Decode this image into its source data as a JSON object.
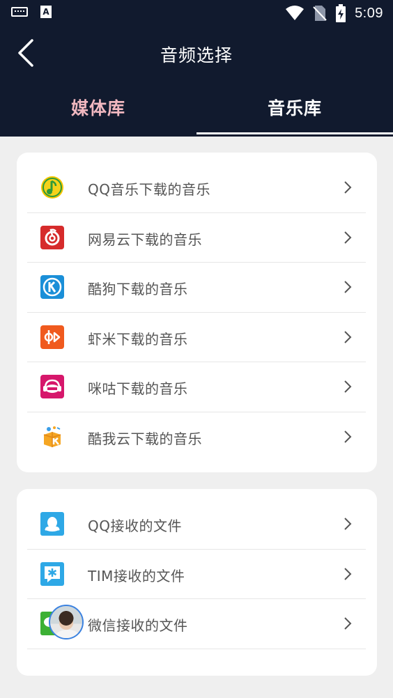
{
  "status_bar": {
    "time": "5:09",
    "icons": [
      "keyboard-icon",
      "a-app-icon",
      "wifi-icon",
      "no-sim-icon",
      "battery-charging-icon"
    ]
  },
  "header": {
    "title": "音频选择",
    "back_icon": "chevron-left-icon",
    "bg_color": "#111a2e"
  },
  "tabs": [
    {
      "label": "媒体库",
      "active": false,
      "color": "#f1b8c0"
    },
    {
      "label": "音乐库",
      "active": true,
      "color": "#ffffff"
    }
  ],
  "music_sources": [
    {
      "label": "QQ音乐下载的音乐",
      "icon": "qq-music-icon",
      "color": "#f7c600"
    },
    {
      "label": "网易云下载的音乐",
      "icon": "netease-cloud-music-icon",
      "color": "#d62b2b"
    },
    {
      "label": "酷狗下载的音乐",
      "icon": "kugou-icon",
      "color": "#1a8fd8"
    },
    {
      "label": "虾米下载的音乐",
      "icon": "xiami-icon",
      "color": "#f05a1e"
    },
    {
      "label": "咪咕下载的音乐",
      "icon": "migu-icon",
      "color": "#d6176b"
    },
    {
      "label": "酷我云下载的音乐",
      "icon": "kuwo-icon",
      "color": "#f5a623"
    }
  ],
  "file_sources": [
    {
      "label": "QQ接收的文件",
      "icon": "qq-icon",
      "color": "#2ea8e6"
    },
    {
      "label": "TIM接收的文件",
      "icon": "tim-icon",
      "color": "#2ea8e6"
    },
    {
      "label": "微信接收的文件",
      "icon": "wechat-icon",
      "color": "#3cb034"
    }
  ]
}
